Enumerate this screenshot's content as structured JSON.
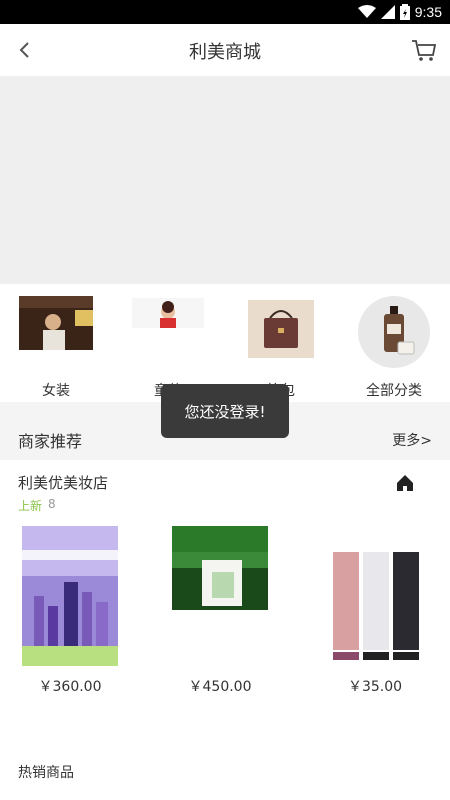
{
  "status_bar": {
    "time": "9:35"
  },
  "header": {
    "title": "利美商城"
  },
  "categories": [
    {
      "label": "女装"
    },
    {
      "label": "童装"
    },
    {
      "label": "箱包"
    },
    {
      "label": "全部分类"
    }
  ],
  "recommend": {
    "title": "商家推荐",
    "more": "更多>"
  },
  "store": {
    "name": "利美优美妆店",
    "new_label": "上新",
    "new_count": "8",
    "products": [
      {
        "price": "￥360.00"
      },
      {
        "price": "￥450.00"
      },
      {
        "price": "￥35.00"
      }
    ]
  },
  "hot": {
    "title": "热销商品"
  },
  "toast": {
    "text": "您还没登录!"
  },
  "colors": {
    "accent_green": "#8bc34a",
    "toast_bg": "#3a3a3a"
  }
}
